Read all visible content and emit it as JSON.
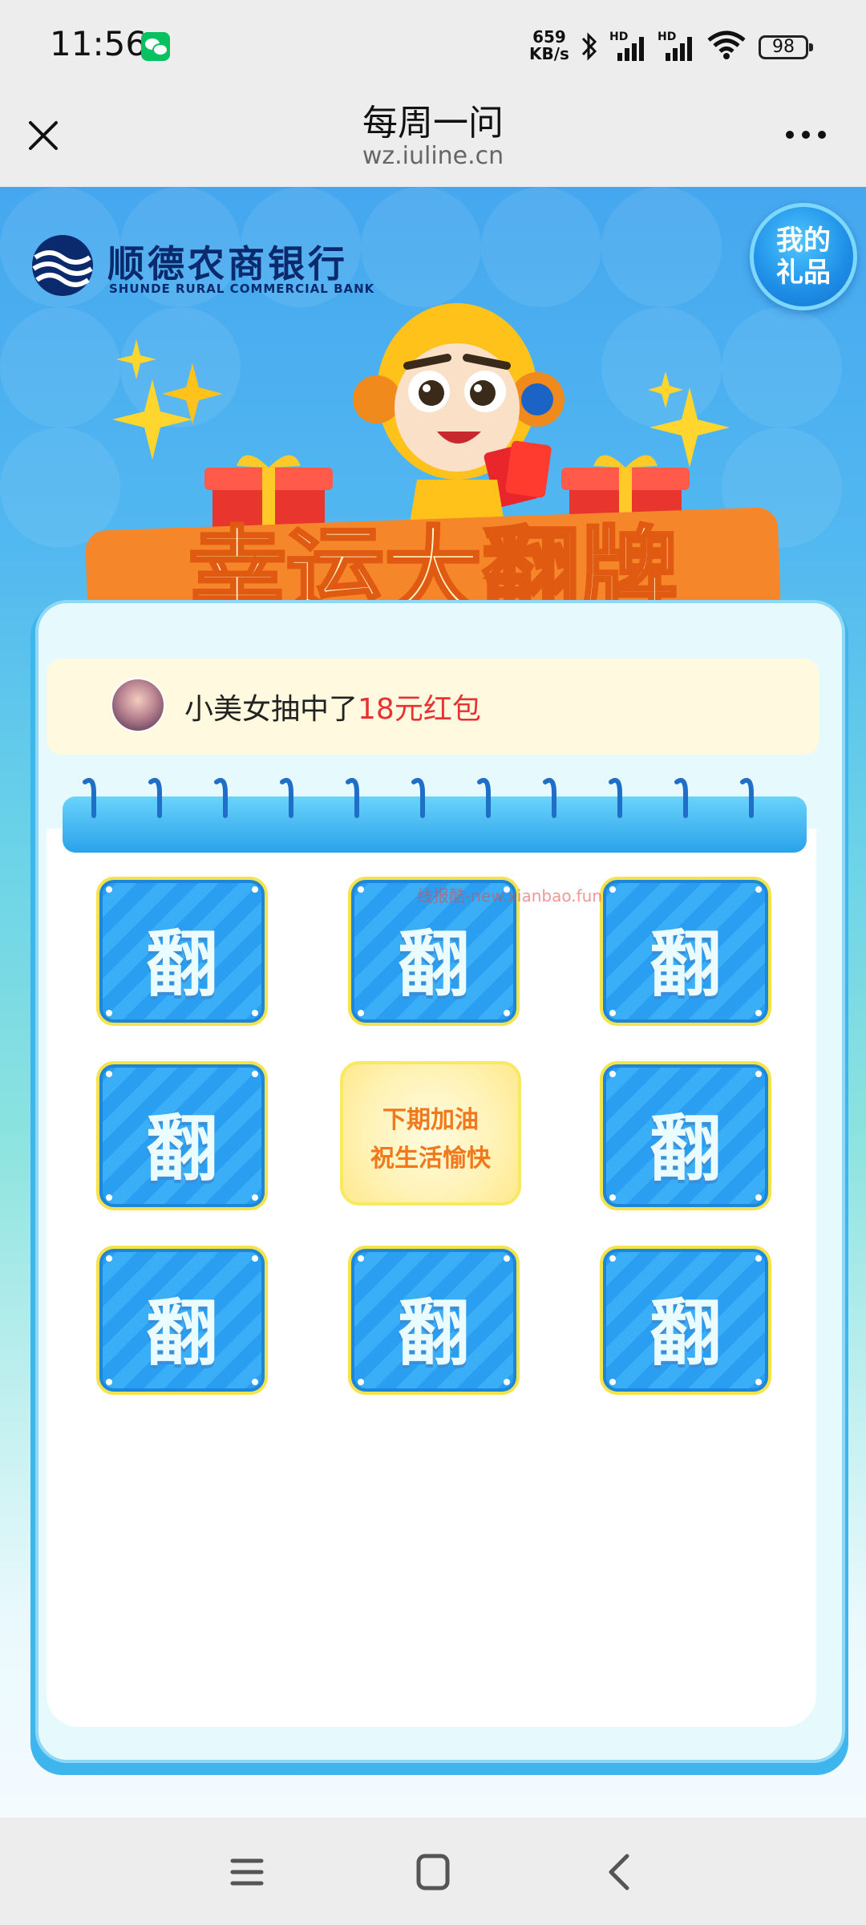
{
  "status_bar": {
    "time": "11:56",
    "net_speed_value": "659",
    "net_speed_unit": "KB/s",
    "signal_label": "HD",
    "battery": "98",
    "icons": [
      "wechat-icon",
      "bluetooth-icon",
      "signal-icon",
      "wifi-icon",
      "battery-icon"
    ]
  },
  "nav": {
    "title": "每周一问",
    "url": "wz.iuline.cn",
    "close_icon": "close-icon",
    "more_icon": "more-icon"
  },
  "banner": {
    "bank_name_cn": "顺德农商银行",
    "bank_name_en": "SHUNDE RURAL COMMERCIAL BANK",
    "my_gifts_line1": "我的",
    "my_gifts_line2": "礼品",
    "headline": "幸运大翻牌"
  },
  "winner": {
    "user_text": "小美女抽中了",
    "prize": "18元红包"
  },
  "grid": {
    "cards": [
      {
        "label": "翻"
      },
      {
        "label": "翻"
      },
      {
        "label": "翻"
      },
      {
        "label": "翻"
      },
      {
        "label": "",
        "result_line1": "下期加油",
        "result_line2": "祝生活愉快"
      },
      {
        "label": "翻"
      },
      {
        "label": "翻"
      },
      {
        "label": "翻"
      },
      {
        "label": "翻"
      }
    ]
  },
  "watermark": "线报酷-new.xianbao.fun",
  "bottom_nav": {
    "icons": [
      "menu-icon",
      "home-icon",
      "back-icon"
    ]
  },
  "colors": {
    "accent_blue": "#2a9ef0",
    "card_border_yellow": "#f6e24a",
    "prize_red": "#e83232",
    "headline_orange": "#f07a1a"
  }
}
